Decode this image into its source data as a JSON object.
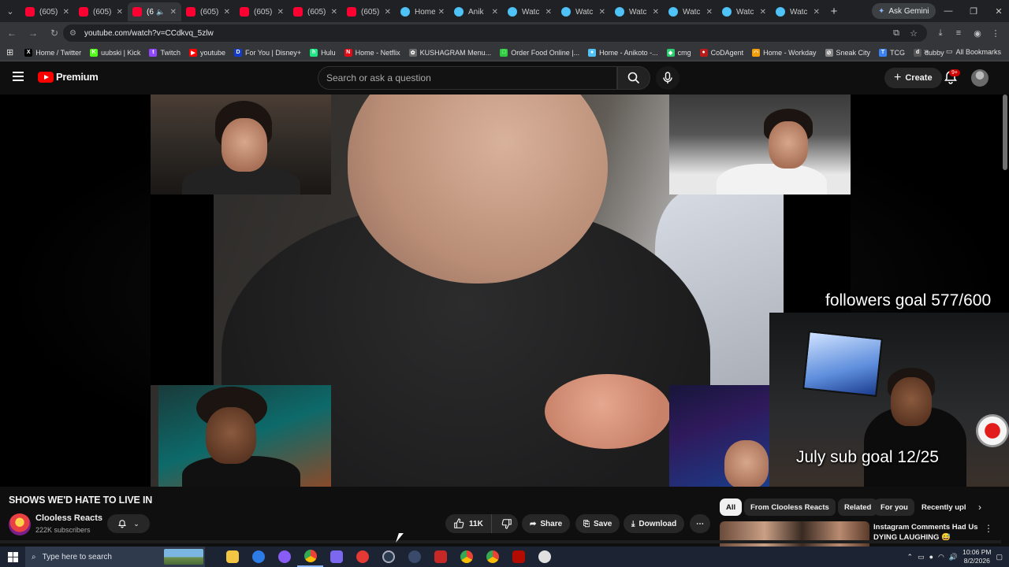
{
  "browser": {
    "tabs": [
      {
        "title": "(605)",
        "favicon": "youtube",
        "active": false
      },
      {
        "title": "(605)",
        "favicon": "youtube",
        "active": false
      },
      {
        "title": "(6",
        "favicon": "youtube",
        "active": true,
        "audio": true
      },
      {
        "title": "(605)",
        "favicon": "youtube",
        "active": false
      },
      {
        "title": "(605)",
        "favicon": "youtube",
        "active": false
      },
      {
        "title": "(605)",
        "favicon": "youtube",
        "active": false
      },
      {
        "title": "(605)",
        "favicon": "youtube",
        "active": false
      },
      {
        "title": "Home",
        "favicon": "anikoto",
        "active": false
      },
      {
        "title": "Anik",
        "favicon": "anikoto",
        "active": false
      },
      {
        "title": "Watc",
        "favicon": "anikoto",
        "active": false
      },
      {
        "title": "Watc",
        "favicon": "anikoto",
        "active": false
      },
      {
        "title": "Watc",
        "favicon": "anikoto",
        "active": false
      },
      {
        "title": "Watc",
        "favicon": "anikoto",
        "active": false
      },
      {
        "title": "Watc",
        "favicon": "anikoto",
        "active": false
      },
      {
        "title": "Watc",
        "favicon": "anikoto",
        "active": false
      }
    ],
    "gemini_label": "Ask Gemini",
    "url": "youtube.com/watch?v=CCdkvq_5zlw",
    "bookmarks": [
      {
        "label": "Home / Twitter",
        "icon": "x",
        "color": "#000000",
        "glyph": "X"
      },
      {
        "label": "uubski | Kick",
        "icon": "kick",
        "color": "#53fc18",
        "glyph": "K"
      },
      {
        "label": "Twitch",
        "icon": "twitch",
        "color": "#9146ff",
        "glyph": "t"
      },
      {
        "label": "youtube",
        "icon": "youtube",
        "color": "#ff0000",
        "glyph": "▶"
      },
      {
        "label": "For You | Disney+",
        "icon": "disney",
        "color": "#113ccf",
        "glyph": "D"
      },
      {
        "label": "Hulu",
        "icon": "hulu",
        "color": "#1ce783",
        "glyph": "h"
      },
      {
        "label": "Home - Netflix",
        "icon": "netflix",
        "color": "#e50914",
        "glyph": "N"
      },
      {
        "label": "KUSHAGRAM Menu...",
        "icon": "kushagram",
        "color": "#6a6a6a",
        "glyph": "✿"
      },
      {
        "label": "Order Food Online |...",
        "icon": "food",
        "color": "#2ecc40",
        "glyph": "□"
      },
      {
        "label": "Home - Anikoto -...",
        "icon": "anikoto",
        "color": "#4fc3f7",
        "glyph": "●"
      },
      {
        "label": "cmg",
        "icon": "cmg",
        "color": "#2ecc71",
        "glyph": "◆"
      },
      {
        "label": "CoDAgent",
        "icon": "codagent",
        "color": "#b71c1c",
        "glyph": "●"
      },
      {
        "label": "Home - Workday",
        "icon": "workday",
        "color": "#f59e0b",
        "glyph": "◠"
      },
      {
        "label": "Sneak City",
        "icon": "sneakcity",
        "color": "#888888",
        "glyph": "⊘"
      },
      {
        "label": "TCG",
        "icon": "tcg",
        "color": "#3b82f6",
        "glyph": "T"
      },
      {
        "label": "dubby",
        "icon": "dubby",
        "color": "#555555",
        "glyph": "d"
      }
    ],
    "all_bookmarks_label": "All Bookmarks"
  },
  "youtube": {
    "logo_label": "Premium",
    "search_placeholder": "Search or ask a question",
    "create_label": "Create",
    "notification_count": "9+",
    "overlay": {
      "followers_goal": "followers goal 577/600",
      "sub_goal": "July sub goal 12/25"
    },
    "video": {
      "title": "SHOWS WE'D HATE TO LIVE IN",
      "channel": "Clooless Reacts",
      "subscribers": "222K subscribers",
      "likes": "11K",
      "share_label": "Share",
      "save_label": "Save",
      "download_label": "Download"
    },
    "chips": [
      "All",
      "From Clooless Reacts",
      "Related",
      "For you",
      "Recently upl"
    ],
    "recommendation": {
      "title": "Instagram Comments Had Us DYING LAUGHING 😅"
    }
  },
  "taskbar": {
    "search_placeholder": "Type here to search",
    "time": "10:06 PM",
    "date": "8/2/2026"
  }
}
